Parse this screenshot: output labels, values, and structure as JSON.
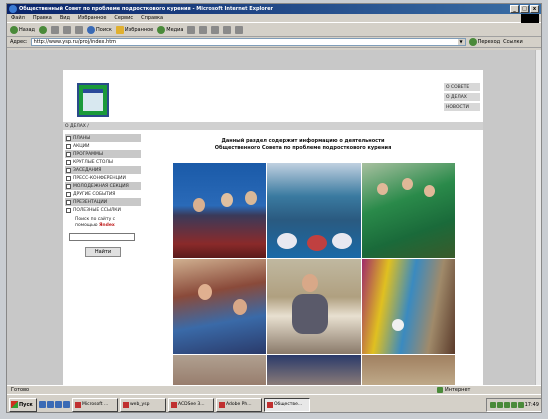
{
  "window": {
    "title": "Общественный Совет по проблеме подросткового курения - Microsoft Internet Explorer",
    "buttons": [
      "_",
      "□",
      "x"
    ]
  },
  "menubar": [
    "Файл",
    "Правка",
    "Вид",
    "Избранное",
    "Сервис",
    "Справка"
  ],
  "toolbar": {
    "back": "Назад",
    "search": "Поиск",
    "favorites": "Избранное",
    "media": "Медиа"
  },
  "addressbar": {
    "label": "Адрес:",
    "url": "http://www.ysp.ru/proj/index.htm",
    "go": "Переход",
    "links": "Ссылки"
  },
  "page": {
    "topnav": [
      "О СОВЕТЕ",
      "О ДЕЛАХ",
      "НОВОСТИ"
    ],
    "breadcrumb": "О ДЕЛАХ /",
    "leftnav": [
      {
        "label": "ПЛАНЫ",
        "shaded": true
      },
      {
        "label": "АКЦИИ",
        "shaded": false
      },
      {
        "label": "ПРОГРАММЫ",
        "shaded": true
      },
      {
        "label": "КРУГЛЫЕ СТОЛЫ",
        "shaded": false
      },
      {
        "label": "ЗАСЕДАНИЯ",
        "shaded": true
      },
      {
        "label": "ПРЕСС-КОНФЕРЕНЦИИ",
        "shaded": false
      },
      {
        "label": "МОЛОДЕЖНАЯ СЕКЦИЯ",
        "shaded": true
      },
      {
        "label": "ДРУГИЕ СОБЫТИЯ",
        "shaded": false
      },
      {
        "label": "ПРЕЗЕНТАЦИИ",
        "shaded": true
      },
      {
        "label": "ПОЛЕЗНЫЕ ССЫЛКИ",
        "shaded": false
      }
    ],
    "search": {
      "label_prefix": "Поиск по сайту с помощью",
      "brand": "Яndex",
      "button": "Найти"
    },
    "intro_line1": "Данный раздел содержит информацию о деятельности",
    "intro_line2": "Общественного Совета по проблеме подросткового курения"
  },
  "statusbar": {
    "status": "Готово",
    "zone": "Интернет"
  },
  "taskbar": {
    "start": "Пуск",
    "tasks": [
      {
        "label": "Microsoft ...",
        "active": false
      },
      {
        "label": "web_ysp",
        "active": false
      },
      {
        "label": "ACDSee 3...",
        "active": false
      },
      {
        "label": "Adobe Ph...",
        "active": false
      },
      {
        "label": "Обществе...",
        "active": true
      }
    ],
    "clock": "17:49"
  }
}
